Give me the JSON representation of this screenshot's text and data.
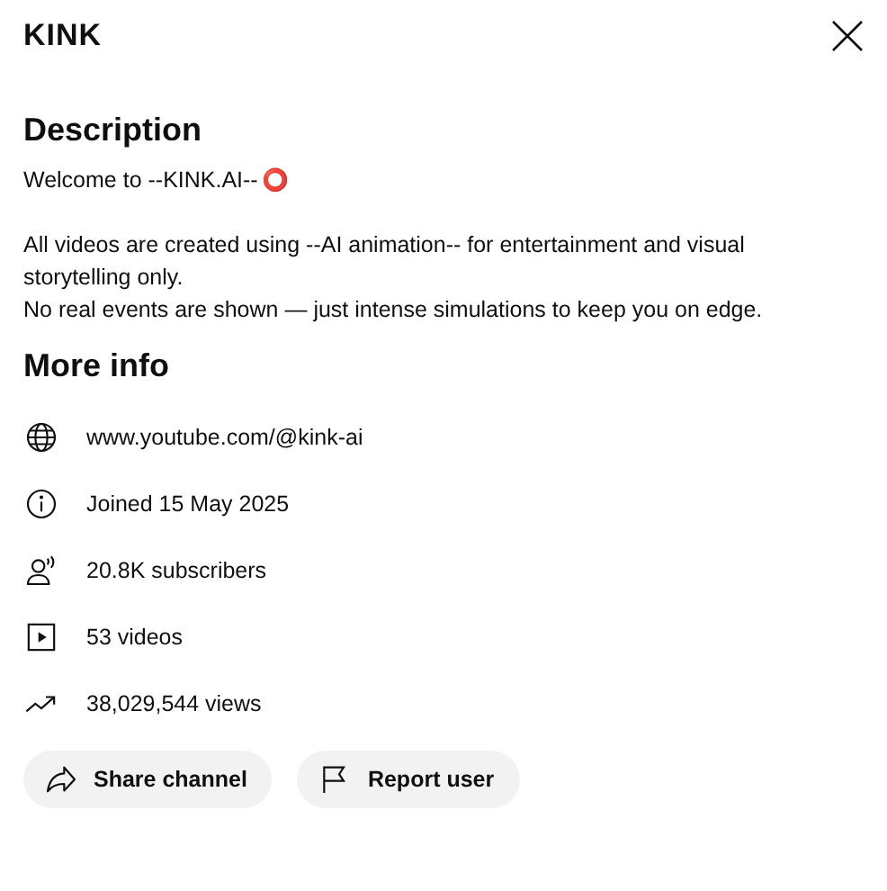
{
  "channel": {
    "name": "KINK"
  },
  "description": {
    "heading": "Description",
    "welcome": "Welcome to --KINK.AI--",
    "welcome_emoji": "⭕",
    "paragraphs": [
      "All videos are created using --AI animation-- for entertainment and visual storytelling only.",
      "No real events are shown — just intense simulations to keep you on edge."
    ]
  },
  "more_info": {
    "heading": "More info",
    "rows": [
      {
        "kind": "link",
        "text": "www.youtube.com/@kink-ai"
      },
      {
        "kind": "joined",
        "text": "Joined 15 May 2025"
      },
      {
        "kind": "subscribers",
        "text": "20.8K subscribers"
      },
      {
        "kind": "videos",
        "text": "53 videos"
      },
      {
        "kind": "views",
        "text": "38,029,544 views"
      }
    ]
  },
  "buttons": [
    {
      "kind": "share",
      "label": "Share channel"
    },
    {
      "kind": "report",
      "label": "Report user"
    }
  ]
}
